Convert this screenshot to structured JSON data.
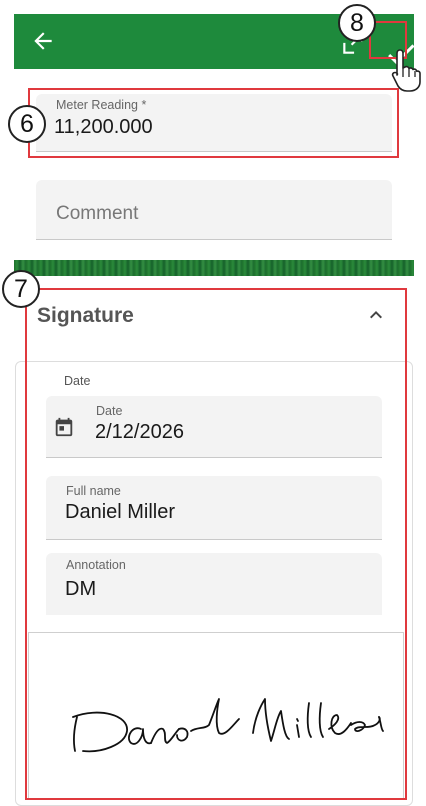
{
  "header": {
    "back_icon": "arrow-left-icon",
    "expand_icon": "expand-icon",
    "confirm_icon": "check-icon"
  },
  "step_badges": {
    "six": "6",
    "seven": "7",
    "eight": "8"
  },
  "meter_reading": {
    "label": "Meter Reading *",
    "value": "11,200.000"
  },
  "comment": {
    "placeholder": "Comment"
  },
  "signature": {
    "title": "Signature",
    "date_group_label": "Date",
    "date": {
      "label": "Date",
      "value": "2/12/2026",
      "icon": "calendar-icon"
    },
    "full_name": {
      "label": "Full name",
      "value": "Daniel Miller"
    },
    "annotation": {
      "label": "Annotation",
      "value": "DM"
    },
    "signed_text": "Daniel Miller"
  },
  "colors": {
    "appbar": "#1e8a3c",
    "highlight": "#e0393e"
  }
}
